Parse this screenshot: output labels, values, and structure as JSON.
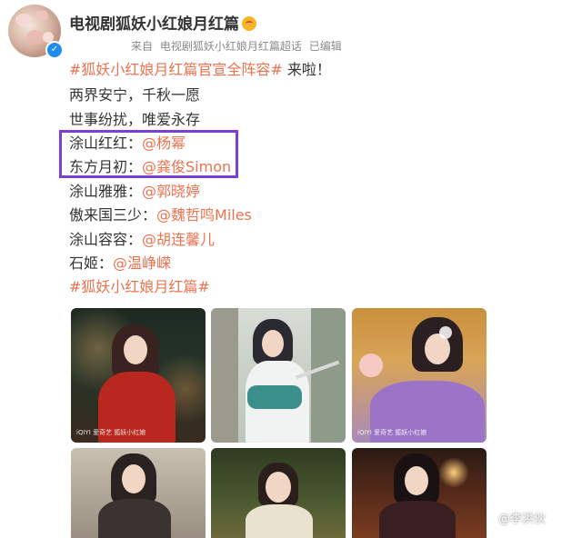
{
  "post": {
    "author": "电视剧狐妖小红娘月红篇",
    "meta": {
      "source_prefix": "来自",
      "source": "电视剧狐妖小红娘月红篇超话",
      "edited": "已编辑"
    },
    "lines": {
      "l1_hashtag": "#狐妖小红娘月红篇官宣全阵容#",
      "l1_text": " 来啦！",
      "l2": "两界安宁，千秋一愿",
      "l3": "世事纷扰，唯爱永存",
      "l4_role": "涂山红红：",
      "l4_mention": "@杨幂",
      "l5_role": "东方月初：",
      "l5_mention": "@龚俊Simon",
      "l6_role": "涂山雅雅：",
      "l6_mention": "@郭晓婷",
      "l7_role": "傲来国三少：",
      "l7_mention": "@魏哲鸣Miles",
      "l8_role": "涂山容容：",
      "l8_mention": "@胡连馨儿",
      "l9_role": "石姬：",
      "l9_mention": "@温峥嵘",
      "l10_hashtag": "#狐妖小红娘月红篇#"
    },
    "photo_tags": {
      "p1": "iQIYI 爱奇艺  狐妖小红娘",
      "p2": "",
      "p3": "iQIYI 爱奇艺  狐妖小红娘"
    }
  },
  "watermark": "@李洪伙",
  "colors": {
    "link": "#eb7350",
    "text": "#333333",
    "meta": "#8a8a8a",
    "highlight_box": "#7b3fd6",
    "verified": "#1e8cf0"
  },
  "icons": [
    "avatar",
    "verified-badge-icon",
    "emoji-icon"
  ]
}
